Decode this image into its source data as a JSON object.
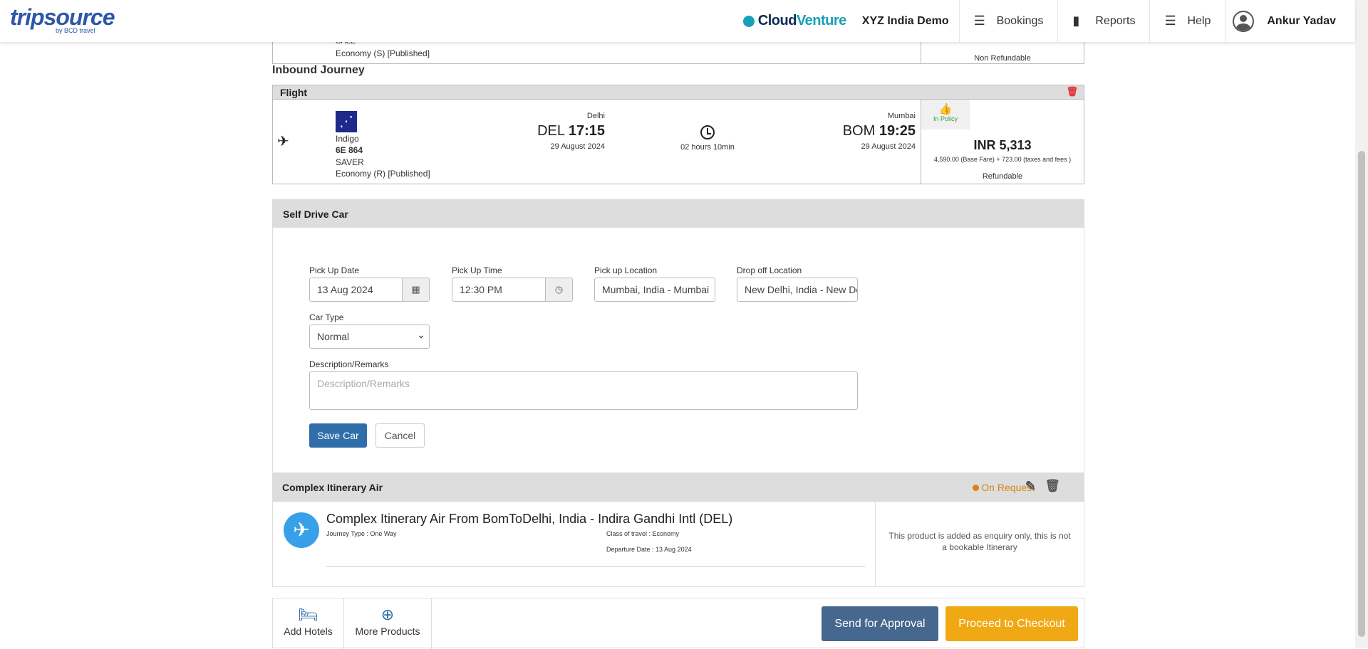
{
  "header": {
    "logo_text": "tripsource",
    "logo_sub": "by BCD travel",
    "brand_a": "Cloud",
    "brand_b": "Venture",
    "company": "XYZ India Demo",
    "nav": [
      {
        "label": "Bookings",
        "icon": "menu-icon"
      },
      {
        "label": "Reports",
        "icon": "bar-chart-icon"
      },
      {
        "label": "Help",
        "icon": "menu-icon"
      }
    ],
    "user": "Ankur Yadav"
  },
  "outbound_tail": {
    "fare_name": "SALE",
    "cabin": "Economy (S) [Published]",
    "refund": "Non Refundable"
  },
  "inbound": {
    "heading": "Inbound Journey",
    "section_label": "Flight",
    "airline": "Indigo",
    "flight_no": "6E 864",
    "fare_name": "SAVER",
    "cabin": "Economy (R) [Published]",
    "dep_city": "Delhi",
    "dep_code": "DEL",
    "dep_time": "17:15",
    "dep_date": "29 August 2024",
    "duration": "02 hours 10min",
    "arr_city": "Mumbai",
    "arr_code": "BOM",
    "arr_time": "19:25",
    "arr_date": "29 August 2024",
    "policy": "In Policy",
    "price": "INR 5,313",
    "breakdown": "4,590.00 (Base Fare) + 723.00 (taxes and fees )",
    "refund": "Refundable"
  },
  "car": {
    "heading": "Self Drive Car",
    "pickup_date_label": "Pick Up Date",
    "pickup_date": "13 Aug 2024",
    "pickup_time_label": "Pick Up Time",
    "pickup_time": "12:30 PM",
    "pickup_loc_label": "Pick up Location",
    "pickup_loc": "Mumbai, India - Mumbai",
    "dropoff_loc_label": "Drop off Location",
    "dropoff_loc": "New Delhi, India - New Delhi",
    "car_type_label": "Car Type",
    "car_type": "Normal",
    "remarks_label": "Description/Remarks",
    "remarks_placeholder": "Description/Remarks",
    "save": "Save Car",
    "cancel": "Cancel"
  },
  "complex": {
    "heading": "Complex Itinerary Air",
    "status": "On Request",
    "status_color": "#d9820f",
    "title": "Complex Itinerary Air From BomToDelhi, India - Indira Gandhi Intl (DEL)",
    "journey_type": "Journey Type : One Way",
    "class": "Class of travel : Economy",
    "departure": "Departure Date : 13 Aug 2024",
    "note": "This product is added as enquiry only, this is not a bookable Itinerary"
  },
  "footer": {
    "add_hotels": "Add Hotels",
    "more_products": "More Products",
    "approval": "Send for Approval",
    "checkout": "Proceed to Checkout"
  }
}
